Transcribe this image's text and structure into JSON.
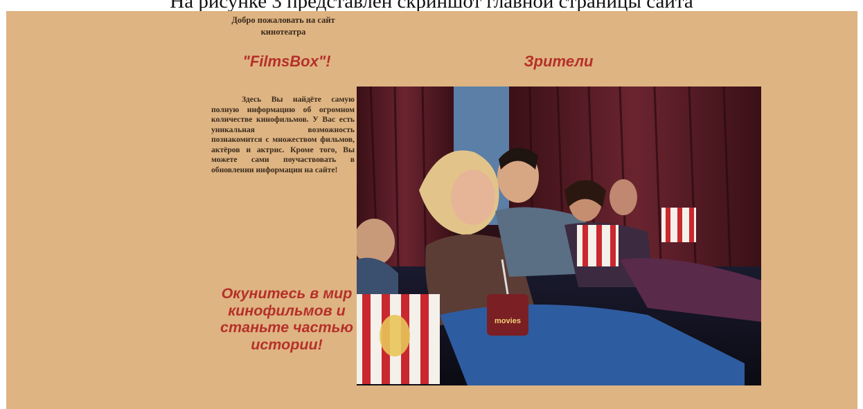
{
  "document": {
    "caption": "На рисунке 3 представлен скриншот главной страницы сайта"
  },
  "site": {
    "welcome_text": "Добро пожаловать на сайт кинотеатра",
    "brand_name": "\"FilmsBox\"!",
    "intro_text": "Здесь Вы найдёте самую полную информацию об огромном количестве кинофильмов. У Вас есть уникальная возможность познакомится с множеством фильмов, актёров и актрис. Кроме того, Вы можете сами поучаствовать в обновлении информации на сайте!",
    "slogan": "Окунитесь в мир кинофильмов и станьте частью истории!",
    "photo_title": "Зрители",
    "photo": {
      "subject": "cinema-audience-photo",
      "popcorn_label": "movies"
    }
  },
  "colors": {
    "page_background": "#deb482",
    "heading_red": "#b5302a",
    "body_text": "#3a2a1c"
  }
}
